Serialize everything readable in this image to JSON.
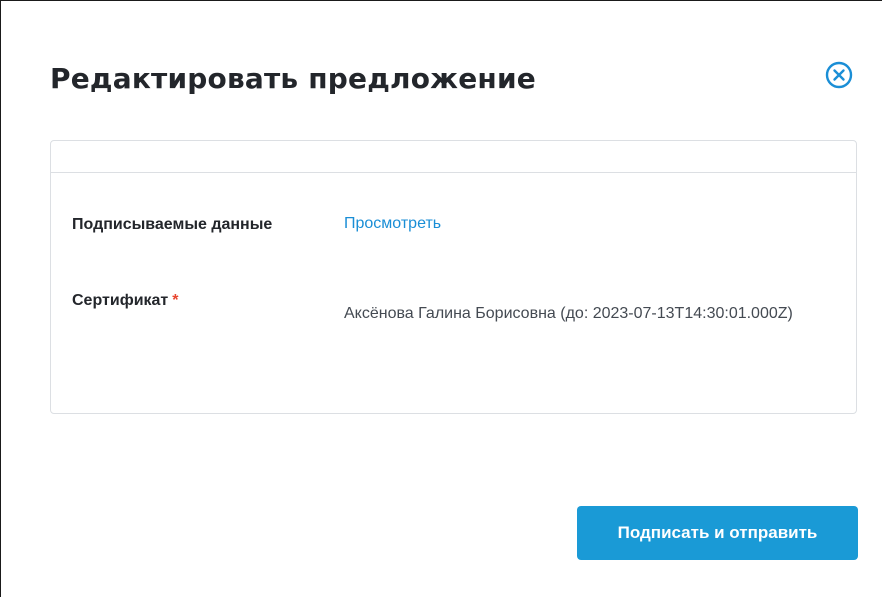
{
  "modal": {
    "title": "Редактировать предложение",
    "close_icon": "close-circle-icon",
    "accent_color": "#1a9ad6"
  },
  "form": {
    "signed_data_label": "Подписываемые данные",
    "view_link": "Просмотреть",
    "certificate_label": "Сертификат",
    "required_mark": "*",
    "certificate_value": "Аксёнова Галина Борисовна (до: 2023-07-13T14:30:01.000Z)"
  },
  "actions": {
    "submit_label": "Подписать и отправить"
  }
}
